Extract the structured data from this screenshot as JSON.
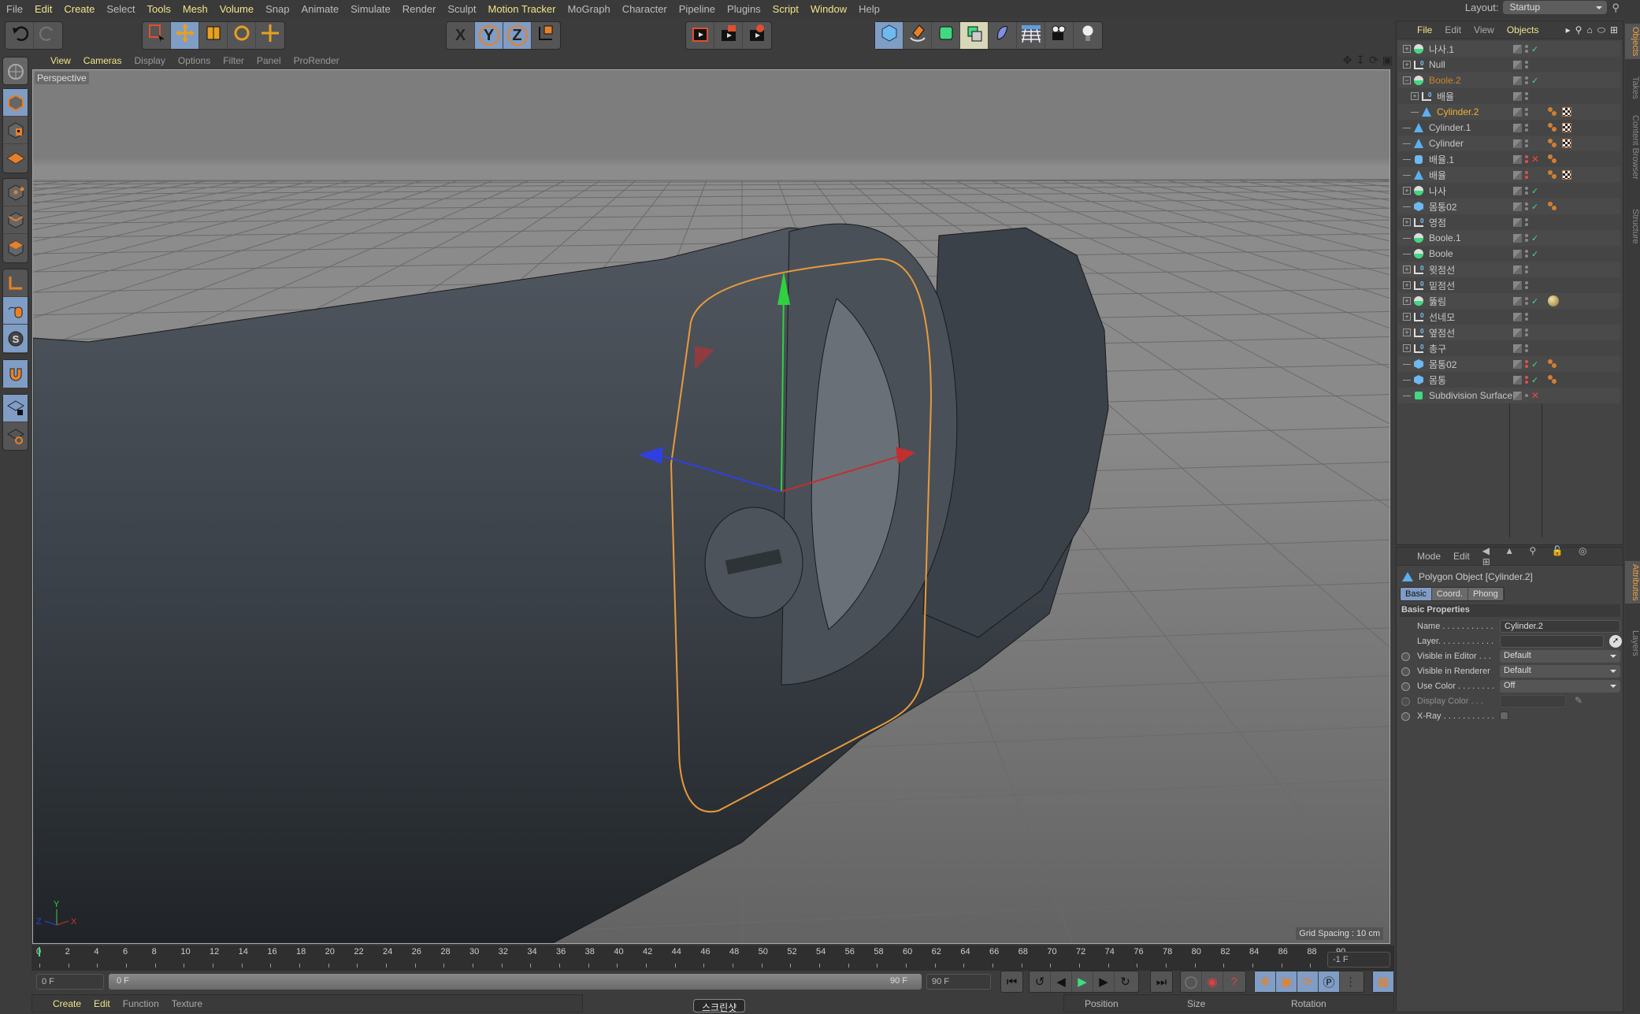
{
  "menubar": {
    "items": [
      {
        "label": "File",
        "hl": false
      },
      {
        "label": "Edit",
        "hl": true
      },
      {
        "label": "Create",
        "hl": true
      },
      {
        "label": "Select",
        "hl": false
      },
      {
        "label": "Tools",
        "hl": true
      },
      {
        "label": "Mesh",
        "hl": true
      },
      {
        "label": "Volume",
        "hl": true
      },
      {
        "label": "Snap",
        "hl": false
      },
      {
        "label": "Animate",
        "hl": false
      },
      {
        "label": "Simulate",
        "hl": false
      },
      {
        "label": "Render",
        "hl": false
      },
      {
        "label": "Sculpt",
        "hl": false
      },
      {
        "label": "Motion Tracker",
        "hl": true
      },
      {
        "label": "MoGraph",
        "hl": false
      },
      {
        "label": "Character",
        "hl": false
      },
      {
        "label": "Pipeline",
        "hl": false
      },
      {
        "label": "Plugins",
        "hl": false
      },
      {
        "label": "Script",
        "hl": true
      },
      {
        "label": "Window",
        "hl": true
      },
      {
        "label": "Help",
        "hl": false
      }
    ],
    "layout_label": "Layout:",
    "layout_value": "Startup"
  },
  "toolbar": {
    "groups": [
      [
        "undo-icon",
        "redo-icon"
      ],
      [
        "live-selection-icon",
        "move-icon",
        "scale-icon",
        "rotate-icon",
        "transform-icon"
      ],
      [
        "x-axis-icon",
        "y-axis-icon",
        "z-axis-icon",
        "coordinate-system-icon"
      ],
      [
        "render-view-icon",
        "render-picture-viewer-icon",
        "render-settings-icon"
      ],
      [
        "cube-icon",
        "pen-icon",
        "subdivision-icon",
        "extrude-icon",
        "deformer-icon",
        "floor-icon",
        "camera-icon",
        "light-icon"
      ]
    ],
    "glyphs": {
      "x-axis-icon": "X",
      "y-axis-icon": "Y",
      "z-axis-icon": "Z"
    }
  },
  "viewport": {
    "menu": [
      {
        "label": "View",
        "hl": true
      },
      {
        "label": "Cameras",
        "hl": true
      },
      {
        "label": "Display",
        "hl": false
      },
      {
        "label": "Options",
        "hl": false
      },
      {
        "label": "Filter",
        "hl": false
      },
      {
        "label": "Panel",
        "hl": false
      },
      {
        "label": "ProRender",
        "hl": false
      }
    ],
    "camera_label": "Perspective",
    "grid_spacing": "Grid Spacing : 10 cm",
    "axis_labels": {
      "x": "X",
      "y": "Y",
      "z": "Z"
    }
  },
  "timeline": {
    "ticks": [
      "0",
      "2",
      "4",
      "6",
      "8",
      "10",
      "12",
      "14",
      "16",
      "18",
      "20",
      "22",
      "24",
      "26",
      "28",
      "30",
      "32",
      "34",
      "36",
      "38",
      "40",
      "42",
      "44",
      "46",
      "48",
      "50",
      "52",
      "54",
      "56",
      "58",
      "60",
      "62",
      "64",
      "66",
      "68",
      "70",
      "72",
      "74",
      "76",
      "78",
      "80",
      "82",
      "84",
      "86",
      "88",
      "90"
    ],
    "current_frame_field": "-1 F",
    "start_field": "0 F",
    "range_start": "0 F",
    "range_end": "90 F",
    "end_field": "90 F"
  },
  "bottom": {
    "material_menu": [
      {
        "label": "Create",
        "hl": true
      },
      {
        "label": "Edit",
        "hl": true
      },
      {
        "label": "Function",
        "hl": false
      },
      {
        "label": "Texture",
        "hl": false
      }
    ],
    "coord_headers": [
      "Position",
      "Size",
      "Rotation"
    ],
    "tooltip": "스크린샷"
  },
  "objects_panel": {
    "menu": [
      {
        "label": "File",
        "hl": true
      },
      {
        "label": "Edit",
        "hl": false
      },
      {
        "label": "View",
        "hl": false
      },
      {
        "label": "Objects",
        "hl": true
      }
    ],
    "rows": [
      {
        "name": "나사.1",
        "type": "boole",
        "indent": 0,
        "expand": "+",
        "dots": "grey",
        "check": "ok",
        "tags": []
      },
      {
        "name": "Null",
        "type": "null",
        "indent": 0,
        "expand": "+",
        "dots": "grey",
        "check": "",
        "tags": []
      },
      {
        "name": "Boole.2",
        "type": "boole",
        "indent": 0,
        "expand": "-",
        "dots": "grey",
        "check": "ok",
        "tags": [],
        "color": "#c8862a"
      },
      {
        "name": "배율",
        "type": "null",
        "indent": 1,
        "expand": "+",
        "dots": "grey",
        "check": "",
        "tags": []
      },
      {
        "name": "Cylinder.2",
        "type": "polygon",
        "indent": 1,
        "expand": "",
        "dots": "grey",
        "check": "",
        "tags": [
          "phong",
          "texture"
        ],
        "color": "#f0b030"
      },
      {
        "name": "Cylinder.1",
        "type": "polygon",
        "indent": 0,
        "expand": "",
        "dots": "grey",
        "check": "",
        "tags": [
          "phong",
          "texture"
        ]
      },
      {
        "name": "Cylinder",
        "type": "polygon",
        "indent": 0,
        "expand": "",
        "dots": "grey",
        "check": "",
        "tags": [
          "phong",
          "texture"
        ]
      },
      {
        "name": "배율.1",
        "type": "cylinder",
        "indent": 0,
        "expand": "",
        "dots": "red",
        "check": "x",
        "tags": [
          "phong"
        ]
      },
      {
        "name": "배율",
        "type": "polygon",
        "indent": 0,
        "expand": "",
        "dots": "red",
        "check": "",
        "tags": [
          "phong",
          "texture"
        ]
      },
      {
        "name": "나사",
        "type": "boole",
        "indent": 0,
        "expand": "+",
        "dots": "grey",
        "check": "ok",
        "tags": []
      },
      {
        "name": "몸통02",
        "type": "cube",
        "indent": 0,
        "expand": "",
        "dots": "grey",
        "check": "ok",
        "tags": [
          "phong"
        ]
      },
      {
        "name": "영점",
        "type": "null",
        "indent": 0,
        "expand": "+",
        "dots": "grey",
        "check": "",
        "tags": []
      },
      {
        "name": "Boole.1",
        "type": "boole",
        "indent": 0,
        "expand": "",
        "dots": "grey",
        "check": "ok",
        "tags": []
      },
      {
        "name": "Boole",
        "type": "boole",
        "indent": 0,
        "expand": "",
        "dots": "grey",
        "check": "ok",
        "tags": []
      },
      {
        "name": "윗점선",
        "type": "null",
        "indent": 0,
        "expand": "+",
        "dots": "grey",
        "check": "",
        "tags": []
      },
      {
        "name": "밑점선",
        "type": "null",
        "indent": 0,
        "expand": "+",
        "dots": "grey",
        "check": "",
        "tags": []
      },
      {
        "name": "뚫림",
        "type": "boole",
        "indent": 0,
        "expand": "+",
        "dots": "grey",
        "check": "ok",
        "tags": [
          "material"
        ]
      },
      {
        "name": "선네모",
        "type": "null",
        "indent": 0,
        "expand": "+",
        "dots": "grey",
        "check": "",
        "tags": []
      },
      {
        "name": "옆점선",
        "type": "null",
        "indent": 0,
        "expand": "+",
        "dots": "grey",
        "check": "",
        "tags": []
      },
      {
        "name": "총구",
        "type": "null",
        "indent": 0,
        "expand": "+",
        "dots": "grey",
        "check": "",
        "tags": []
      },
      {
        "name": "몸통02",
        "type": "cube",
        "indent": 0,
        "expand": "",
        "dots": "red",
        "check": "ok",
        "tags": [
          "phong"
        ]
      },
      {
        "name": "몸통",
        "type": "cube",
        "indent": 0,
        "expand": "",
        "dots": "red",
        "check": "ok",
        "tags": [
          "phong"
        ]
      },
      {
        "name": "Subdivision Surface",
        "type": "subdiv",
        "indent": 0,
        "expand": "",
        "dots": "grey-single",
        "check": "x",
        "tags": []
      }
    ]
  },
  "side_tabs": {
    "top": [
      {
        "label": "Objects",
        "on": true
      },
      {
        "label": "Takes",
        "on": false
      },
      {
        "label": "Content Browser",
        "on": false
      },
      {
        "label": "Structure",
        "on": false
      }
    ],
    "bottom": [
      {
        "label": "Attributes",
        "on": true
      },
      {
        "label": "Layers",
        "on": false
      }
    ]
  },
  "attributes_panel": {
    "menu": [
      "Mode",
      "Edit"
    ],
    "title": "Polygon Object [Cylinder.2]",
    "tabs": [
      {
        "label": "Basic",
        "on": true
      },
      {
        "label": "Coord.",
        "on": false
      },
      {
        "label": "Phong",
        "on": false
      }
    ],
    "section": "Basic Properties",
    "props": [
      {
        "label": "Name . . . . . . . . . . .",
        "value": "Cylinder.2",
        "kind": "text",
        "radio": false
      },
      {
        "label": "Layer. . . . . . . . . . . .",
        "value": "",
        "kind": "layer",
        "radio": false
      },
      {
        "label": "Visible in Editor . . .",
        "value": "Default",
        "kind": "dropdown",
        "radio": true
      },
      {
        "label": "Visible in Renderer",
        "value": "Default",
        "kind": "dropdown",
        "radio": true
      },
      {
        "label": "Use Color . . . . . . . .",
        "value": "Off",
        "kind": "dropdown",
        "radio": true
      },
      {
        "label": "Display Color . . .",
        "value": "",
        "kind": "color",
        "radio": true,
        "disabled": true
      },
      {
        "label": "X-Ray . . . . . . . . . . .",
        "value": "",
        "kind": "checkbox",
        "radio": true
      }
    ]
  },
  "colors": {
    "accent_yellow": "#f2e58a",
    "selected_blue": "#7f9dc5",
    "selection_orange": "#e89a3c",
    "axis_x": "#d03030",
    "axis_y": "#30d040",
    "axis_z": "#3040e0"
  }
}
